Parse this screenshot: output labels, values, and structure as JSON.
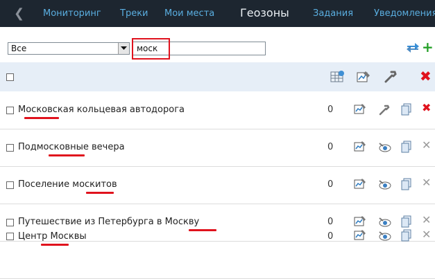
{
  "nav": {
    "back_icon": "chevron-left-icon",
    "tabs": [
      {
        "label": "Мониторинг",
        "active": false
      },
      {
        "label": "Треки",
        "active": false
      },
      {
        "label": "Мои места",
        "active": false
      },
      {
        "label": "Геозоны",
        "active": true
      },
      {
        "label": "Задания",
        "active": false
      },
      {
        "label": "Уведомления",
        "active": false
      }
    ]
  },
  "filters": {
    "group_select_value": "Все",
    "search_value": "моск"
  },
  "header": {
    "icons": [
      "grid-table-icon",
      "chart-edit-icon",
      "wrench-icon",
      "delete-all-icon"
    ]
  },
  "rows": [
    {
      "name": "Московская кольцевая автодорога",
      "count": "0",
      "delete_color": "red"
    },
    {
      "name": "Подмосковные вечера",
      "count": "0",
      "delete_color": "grey"
    },
    {
      "name": "Поселение москитов",
      "count": "0",
      "delete_color": "grey"
    },
    {
      "name": "Путешествие из Петербурга в Москву",
      "count": "0",
      "delete_color": "grey"
    },
    {
      "name": "Центр Москвы",
      "count": "0",
      "delete_color": "grey"
    }
  ],
  "colors": {
    "nav_bg": "#1d2630",
    "nav_link": "#5aaee0",
    "highlight": "#e0121d",
    "header_band": "#e6eef7",
    "add": "#27a12a"
  }
}
